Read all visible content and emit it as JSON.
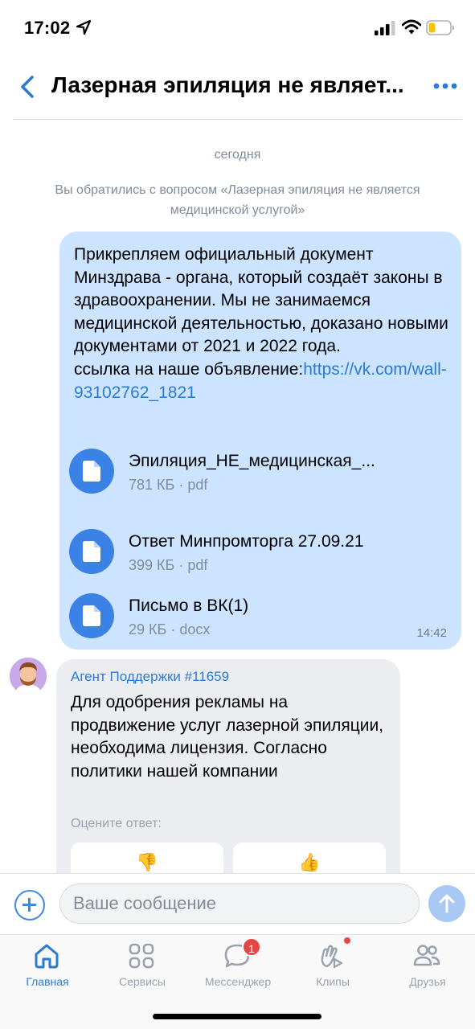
{
  "status_bar": {
    "time": "17:02"
  },
  "header": {
    "title": "Лазерная эпиляция не являет..."
  },
  "feed": {
    "date_separator": "сегодня",
    "system_message": "Вы обратились с вопросом «Лазерная эпиляция не является медицинской услугой»",
    "outgoing": {
      "text": "Прикрепляем официальный документ Минздрава - органа, который создаёт законы в здравоохранении. Мы не занимаемся медицинской деятельностью, доказано новыми документами от 2021 и 2022 года.",
      "link_prefix": "ссылка на наше объявление:",
      "link": "https://vk.com/wall-93102762_1821",
      "attachments": [
        {
          "name": "Эпиляция_НЕ_медицинская_...",
          "meta": "781 КБ · pdf",
          "icon": "document-icon"
        },
        {
          "name": "Ответ Минпромторга 27.09.21",
          "meta": "399 КБ · pdf",
          "icon": "document-icon"
        },
        {
          "name": "Письмо в ВК(1)",
          "meta": "29 КБ · docx",
          "icon": "document-icon"
        }
      ],
      "time": "14:42"
    },
    "incoming": {
      "sender": "Агент Поддержки #11659",
      "text": "Для одобрения рекламы на продвижение услуг лазерной эпиляции, необходима лицензия. Согласно политики нашей компании",
      "rate_label": "Оцените ответ:",
      "rate_options": [
        "👎",
        "👍"
      ]
    }
  },
  "composer": {
    "placeholder": "Ваше сообщение"
  },
  "tab_bar": {
    "tabs": [
      {
        "label": "Главная",
        "icon": "home-icon",
        "active": true
      },
      {
        "label": "Сервисы",
        "icon": "services-icon"
      },
      {
        "label": "Мессенджер",
        "icon": "messenger-icon",
        "badge": "1"
      },
      {
        "label": "Клипы",
        "icon": "clips-icon"
      },
      {
        "label": "Друзья",
        "icon": "friends-icon"
      }
    ]
  },
  "colors": {
    "accent": "#2a7bd4",
    "outgoing_bubble": "#cce4ff",
    "incoming_bubble": "#ebedf0",
    "badge": "#e64646"
  }
}
